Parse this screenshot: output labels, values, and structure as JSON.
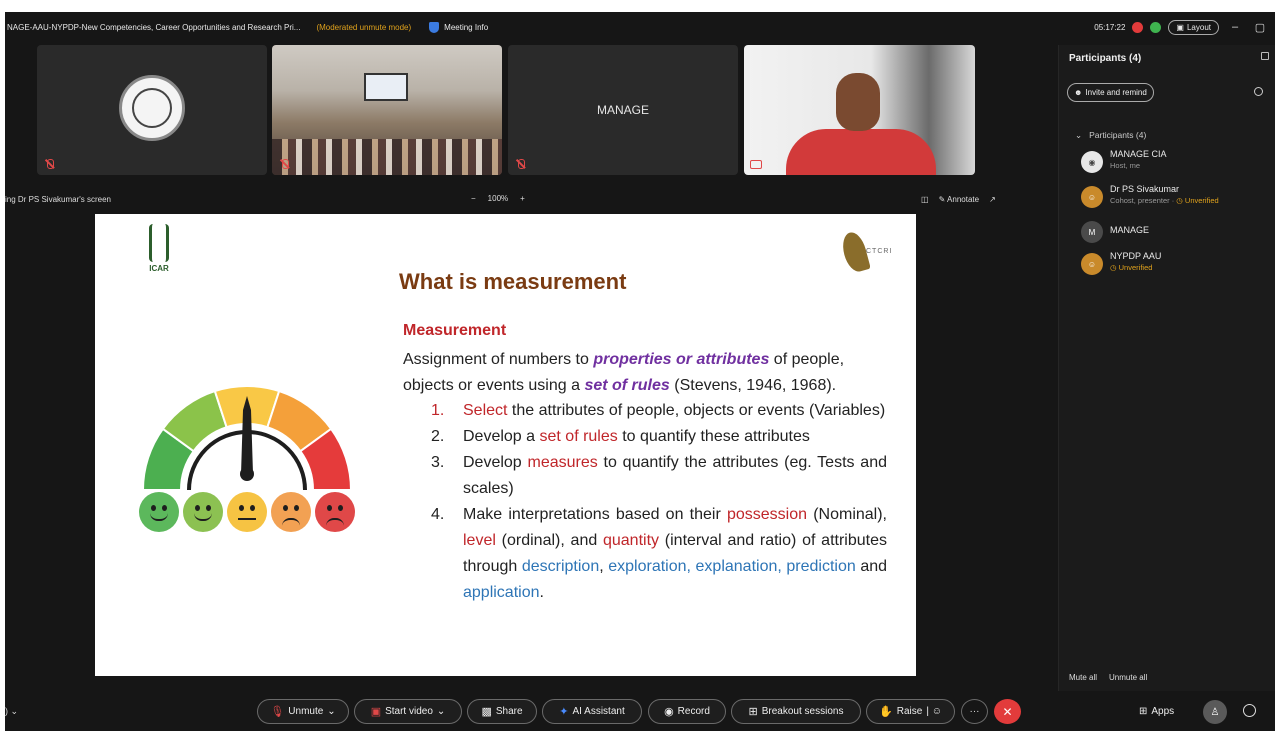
{
  "titlebar": {
    "title": "NAGE-AAU-NYPDP-New Competencies, Career Opportunities and Research Pri...",
    "mode": "(Moderated unmute mode)",
    "meeting_info": "Meeting Info",
    "time": "05:17:22",
    "layout": "Layout",
    "minimize": "–",
    "restore": "▢"
  },
  "tiles": {
    "manage_label": "MANAGE"
  },
  "sharebar": {
    "viewing": "ing Dr PS Sivakumar's screen",
    "zoom_out": "−",
    "zoom": "100%",
    "zoom_in": "+",
    "annotate": "Annotate"
  },
  "slide": {
    "logo_left": "ICAR",
    "logo_right": "CTCRI",
    "title": "What is measurement",
    "subheading": "Measurement",
    "para_1": "Assignment of numbers to ",
    "para_em1": "properties or attributes",
    "para_2": " of people, objects or events using a ",
    "para_em2": "set of rules",
    "para_3": " (Stevens, 1946, 1968).",
    "items": [
      {
        "num": "1.",
        "a": "Select",
        "b": " the attributes of people, objects or events (Variables)"
      },
      {
        "num": "2.",
        "a": "Develop a ",
        "b": "set of rules",
        "c": " to quantify these attributes"
      },
      {
        "num": "3.",
        "a": "Develop ",
        "b": "measures",
        "c": " to quantify the attributes (eg. Tests and scales)"
      },
      {
        "num": "4.",
        "a": "Make interpretations based on their ",
        "b": "possession",
        "c": " (Nominal), ",
        "d": "level",
        "e": " (ordinal), and ",
        "f": "quantity",
        "g": " (interval and ratio) of attributes through ",
        "h": "description",
        "i": ", ",
        "j": "exploration, explanation, prediction",
        "k": " and ",
        "l": "application",
        "m": "."
      }
    ],
    "gauge_colors": [
      "#4caf50",
      "#8bc34a",
      "#f9c846",
      "#f4a03a",
      "#e53b3b"
    ],
    "emoji_colors": [
      "#5cb85c",
      "#8cc152",
      "#f6c343",
      "#f2a153",
      "#e04848"
    ]
  },
  "participants": {
    "header": "Participants (4)",
    "invite": "Invite and remind",
    "group": "Participants (4)",
    "list": [
      {
        "initials": "",
        "name": "MANAGE CIA",
        "meta": "Host, me",
        "color": "#e8e8e8"
      },
      {
        "initials": "",
        "name": "Dr PS Sivakumar",
        "meta": "Cohost, presenter · ",
        "unverified": "Unverified",
        "color": "#c98a2b"
      },
      {
        "initials": "M",
        "name": "MANAGE",
        "meta": "",
        "color": "#4a4a4a"
      },
      {
        "initials": "",
        "name": "NYPDP AAU",
        "meta": "",
        "unverified": "Unverified",
        "color": "#c98a2b"
      }
    ],
    "mute_all": "Mute all",
    "unmute_all": "Unmute all"
  },
  "controls": {
    "unmute": "Unmute",
    "start_video": "Start video",
    "share": "Share",
    "ai_assistant": "AI Assistant",
    "record": "Record",
    "breakout": "Breakout sessions",
    "raise": "Raise",
    "more": "···",
    "end": "✕",
    "apps": "Apps"
  }
}
